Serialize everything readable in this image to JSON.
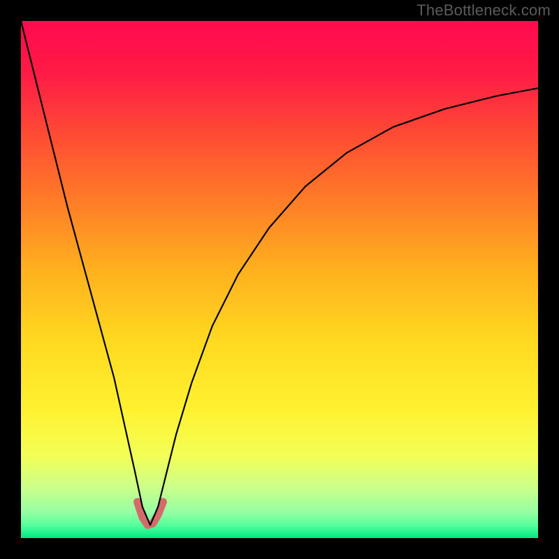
{
  "watermark": "TheBottleneck.com",
  "gradient_stops": [
    {
      "offset": 0.0,
      "color": "#ff0a50"
    },
    {
      "offset": 0.1,
      "color": "#ff1b46"
    },
    {
      "offset": 0.22,
      "color": "#ff4b34"
    },
    {
      "offset": 0.35,
      "color": "#ff7d27"
    },
    {
      "offset": 0.48,
      "color": "#ffb01e"
    },
    {
      "offset": 0.62,
      "color": "#ffd920"
    },
    {
      "offset": 0.75,
      "color": "#fff12f"
    },
    {
      "offset": 0.84,
      "color": "#f3ff55"
    },
    {
      "offset": 0.9,
      "color": "#ccff88"
    },
    {
      "offset": 0.95,
      "color": "#96ffa4"
    },
    {
      "offset": 0.975,
      "color": "#56ff9c"
    },
    {
      "offset": 1.0,
      "color": "#00e884"
    }
  ],
  "curve": {
    "stroke": "#000000",
    "stroke_width": 2.2
  },
  "highlight": {
    "stroke": "#d46a6a",
    "stroke_width": 11
  },
  "chart_data": {
    "type": "line",
    "title": "",
    "xlabel": "",
    "ylabel": "",
    "xlim": [
      0,
      100
    ],
    "ylim": [
      0,
      100
    ],
    "note": "x/y in percent of plot area; y=0 is bottom (no-bottleneck), y=100 is top (max bottleneck). Curve minimum near x≈25.",
    "series": [
      {
        "name": "bottleneck-curve",
        "x": [
          0,
          3,
          6,
          9,
          12,
          15,
          18,
          20,
          22,
          23.5,
          25,
          26.5,
          28,
          30,
          33,
          37,
          42,
          48,
          55,
          63,
          72,
          82,
          92,
          100
        ],
        "y": [
          100,
          88,
          76,
          64,
          53,
          42,
          31,
          22,
          13,
          6,
          2.5,
          6,
          12,
          20,
          30,
          41,
          51,
          60,
          68,
          74.5,
          79.5,
          83,
          85.5,
          87
        ]
      },
      {
        "name": "highlighted-minimum",
        "x": [
          22.5,
          23.5,
          24.5,
          25.5,
          26.5,
          27.5
        ],
        "y": [
          7,
          4,
          2.5,
          2.8,
          4.5,
          7
        ]
      }
    ]
  }
}
